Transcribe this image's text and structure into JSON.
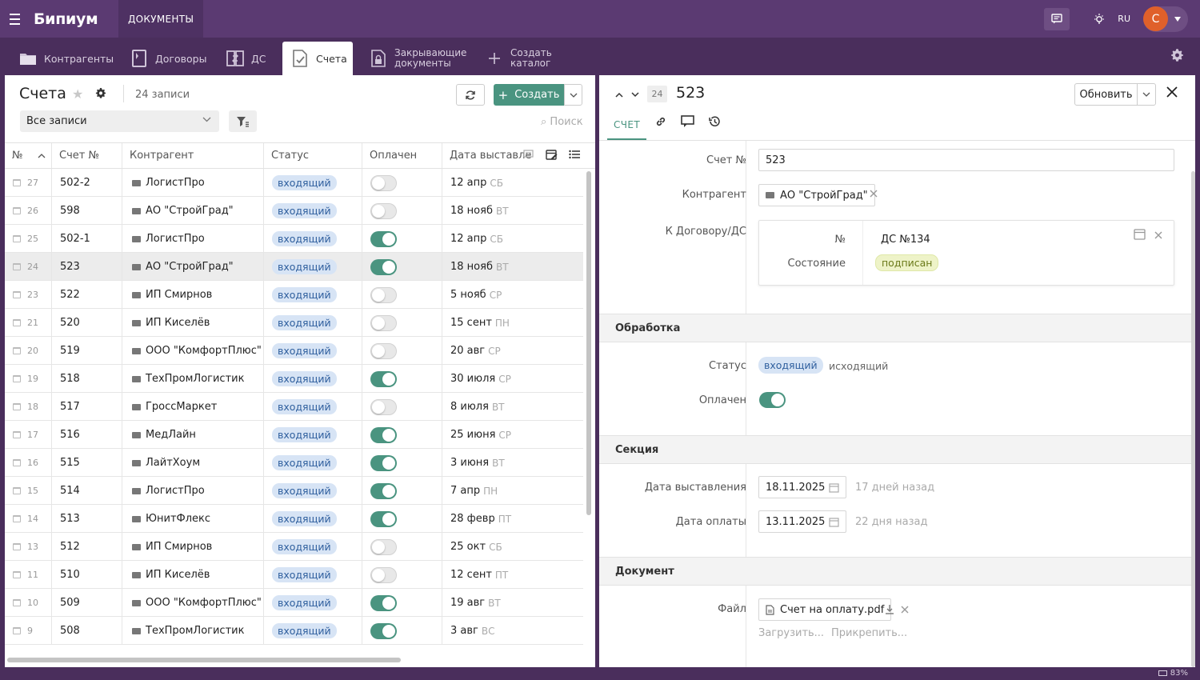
{
  "app": {
    "logo": "Бипиум",
    "top_tab": "ДОКУМЕНТЫ",
    "lang": "RU",
    "user_initial": "С"
  },
  "nav": [
    {
      "label": "Контрагенты",
      "icon": "folder-icon"
    },
    {
      "label": "Договоры",
      "icon": "book-icon"
    },
    {
      "label": "ДС",
      "icon": "doc-exchange-icon"
    },
    {
      "label": "Счета",
      "icon": "invoice-icon"
    },
    {
      "label": "Закрывающие\nдокументы",
      "icon": "lock-doc-icon"
    },
    {
      "label": "Создать\nкаталог",
      "icon": "plus-icon"
    }
  ],
  "list": {
    "title": "Счета",
    "count": "24 записи",
    "create_label": "Создать",
    "filter_value": "Все записи",
    "search_placeholder": "Поиск",
    "columns": [
      "№",
      "Счет №",
      "Контрагент",
      "Статус",
      "Оплачен",
      "Дата выставле"
    ],
    "rows": [
      {
        "id": "27",
        "num": "502-2",
        "ctr": "ЛогистПро",
        "status": "входящий",
        "paid": false,
        "date": "12 апр",
        "wd": "СБ"
      },
      {
        "id": "26",
        "num": "598",
        "ctr": "АО \"СтройГрад\"",
        "status": "входящий",
        "paid": false,
        "date": "18 нояб",
        "wd": "ВТ"
      },
      {
        "id": "25",
        "num": "502-1",
        "ctr": "ЛогистПро",
        "status": "входящий",
        "paid": true,
        "date": "12 апр",
        "wd": "СБ"
      },
      {
        "id": "24",
        "num": "523",
        "ctr": "АО \"СтройГрад\"",
        "status": "входящий",
        "paid": true,
        "date": "18 нояб",
        "wd": "ВТ",
        "selected": true
      },
      {
        "id": "23",
        "num": "522",
        "ctr": "ИП Смирнов",
        "status": "входящий",
        "paid": false,
        "date": "5 нояб",
        "wd": "СР"
      },
      {
        "id": "21",
        "num": "520",
        "ctr": "ИП Киселёв",
        "status": "входящий",
        "paid": false,
        "date": "15 сент",
        "wd": "ПН"
      },
      {
        "id": "20",
        "num": "519",
        "ctr": "ООО \"КомфортПлюс\"",
        "status": "входящий",
        "paid": false,
        "date": "20 авг",
        "wd": "СР"
      },
      {
        "id": "19",
        "num": "518",
        "ctr": "ТехПромЛогистик",
        "status": "входящий",
        "paid": true,
        "date": "30 июля",
        "wd": "СР"
      },
      {
        "id": "18",
        "num": "517",
        "ctr": "ГроссМаркет",
        "status": "входящий",
        "paid": false,
        "date": "8 июля",
        "wd": "ВТ"
      },
      {
        "id": "17",
        "num": "516",
        "ctr": "МедЛайн",
        "status": "входящий",
        "paid": true,
        "date": "25 июня",
        "wd": "СР"
      },
      {
        "id": "16",
        "num": "515",
        "ctr": "ЛайтХоум",
        "status": "входящий",
        "paid": true,
        "date": "3 июня",
        "wd": "ВТ"
      },
      {
        "id": "15",
        "num": "514",
        "ctr": "ЛогистПро",
        "status": "входящий",
        "paid": true,
        "date": "7 апр",
        "wd": "ПН"
      },
      {
        "id": "14",
        "num": "513",
        "ctr": "ЮнитФлекс",
        "status": "входящий",
        "paid": true,
        "date": "28 февр",
        "wd": "ПТ"
      },
      {
        "id": "13",
        "num": "512",
        "ctr": "ИП Смирнов",
        "status": "входящий",
        "paid": false,
        "date": "25 окт",
        "wd": "СБ"
      },
      {
        "id": "11",
        "num": "510",
        "ctr": "ИП Киселёв",
        "status": "входящий",
        "paid": false,
        "date": "12 сент",
        "wd": "ПТ"
      },
      {
        "id": "10",
        "num": "509",
        "ctr": "ООО \"КомфортПлюс\"",
        "status": "входящий",
        "paid": true,
        "date": "19 авг",
        "wd": "ВТ"
      },
      {
        "id": "9",
        "num": "508",
        "ctr": "ТехПромЛогистик",
        "status": "входящий",
        "paid": true,
        "date": "3 авг",
        "wd": "ВС"
      }
    ]
  },
  "detail": {
    "record_id": "24",
    "title": "523",
    "update_label": "Обновить",
    "tab_main": "СЧЕТ",
    "labels": {
      "invoice_no": "Счет №",
      "counterparty": "Контрагент",
      "contract": "К Договору/ДС",
      "status": "Статус",
      "paid": "Оплачен",
      "issue_date": "Дата выставления",
      "pay_date": "Дата оплаты",
      "file": "Файл"
    },
    "invoice_no": "523",
    "counterparty": "АО \"СтройГрад\"",
    "contract": {
      "no_label": "№",
      "no_value": "ДС №134",
      "state_label": "Состояние",
      "state_value": "подписан"
    },
    "sections": {
      "processing": "Обработка",
      "section": "Секция",
      "document": "Документ"
    },
    "status_options": [
      "входящий",
      "исходящий"
    ],
    "paid": true,
    "issue_date": "18.11.2025",
    "issue_rel": "17 дней назад",
    "pay_date": "13.11.2025",
    "pay_rel": "22 дня назад",
    "file_name": "Счет на оплату.pdf",
    "upload_label": "Загрузить...",
    "attach_label": "Прикрепить..."
  },
  "zoom": "83%",
  "colors": {
    "brand": "#5b3a72",
    "accent": "#4a9480",
    "badge_bg": "#d7e4f5"
  }
}
